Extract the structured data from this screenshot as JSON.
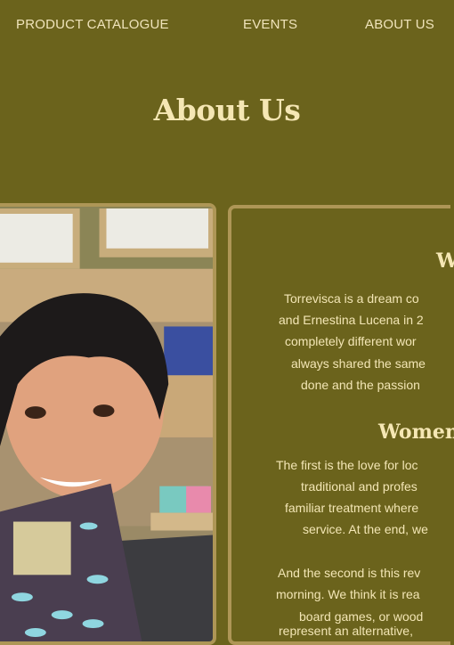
{
  "nav": {
    "items": [
      {
        "label": "PRODUCT CATALOGUE"
      },
      {
        "label": "EVENTS"
      },
      {
        "label": "ABOUT US"
      }
    ]
  },
  "page_title": "About Us",
  "card": {
    "heading1": "W",
    "para1": [
      "Torrevisca is a dream co",
      "and Ernestina Lucena in 2",
      "completely different wor",
      "always shared the same",
      "done and the passion"
    ],
    "heading2": "Women",
    "para2": [
      "The first is the love for loc",
      "traditional and profes",
      "familiar treatment where",
      "service. At the end, we"
    ],
    "para3": [
      "And the second is this rev",
      "morning. We think it is rea",
      "board games, or wood",
      "represent an alternative,"
    ]
  },
  "colors": {
    "background": "#6b631c",
    "text": "#f3e6b5",
    "border": "#ae9656"
  }
}
